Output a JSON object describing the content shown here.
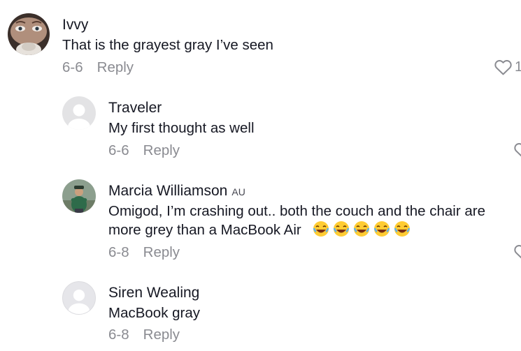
{
  "comments": [
    {
      "name": "Ivvy",
      "badge": "",
      "text": "That is the grayest gray I’ve seen",
      "date": "6-6",
      "reply": "Reply",
      "likes": "1"
    },
    {
      "name": "Traveler",
      "badge": "",
      "text": "My first thought as well",
      "date": "6-6",
      "reply": "Reply",
      "likes": ""
    },
    {
      "name": "Marcia Williamson",
      "badge": "AU",
      "text": "Omigod, I’m crashing out.. both the couch and the chair are more grey than a MacBook Air",
      "emoji": "😂😂😂😂😂",
      "date": "6-8",
      "reply": "Reply",
      "likes": ""
    },
    {
      "name": "Siren Wealing",
      "badge": "",
      "text": "MacBook gray",
      "date": "6-8",
      "reply": "Reply",
      "likes": ""
    }
  ],
  "icons": {
    "like": "heart-outline-icon"
  }
}
